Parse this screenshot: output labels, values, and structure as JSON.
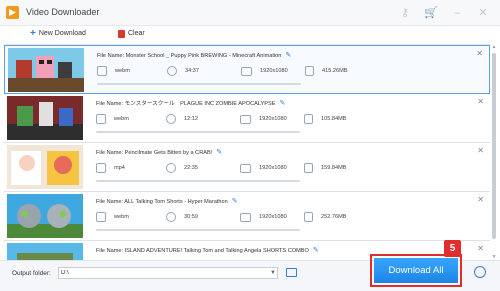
{
  "window": {
    "title": "Video Downloader"
  },
  "colors": {
    "accent": "#2e7fd8",
    "danger": "#e02d2d",
    "download_button": "#1d84e5"
  },
  "toolbar": {
    "new_download_label": "New Download",
    "clear_label": "Clear"
  },
  "list": {
    "filename_prefix": "File Name: ",
    "items": [
      {
        "filename": "Monster School _ Puppy Pink BREWING - Minecraft Animation",
        "format": "webm",
        "duration": "34:37",
        "resolution": "1920x1080",
        "size": "415.26MB",
        "progress": 0,
        "selected": true
      },
      {
        "filename": "モンスタースクール　PLAGUE INC ZOMBIE APOCALYPSE",
        "format": "webm",
        "duration": "12:12",
        "resolution": "1920x1080",
        "size": "105.84MB",
        "progress": 0,
        "selected": false
      },
      {
        "filename": "Pencilmate Gets Bitten by a CRAB!",
        "format": "mp4",
        "duration": "22:35",
        "resolution": "1920x1080",
        "size": "159.84MB",
        "progress": 0,
        "selected": false
      },
      {
        "filename": "ALL Talking Tom Shorts - Hyper Marathon",
        "format": "webm",
        "duration": "30:59",
        "resolution": "1920x1080",
        "size": "252.76MB",
        "progress": 0,
        "selected": false
      },
      {
        "filename": "ISLAND ADVENTURE! Talking Tom and Talking Angela SHORTS COMBO",
        "format": "",
        "duration": "",
        "resolution": "",
        "size": "",
        "progress": 0,
        "selected": false
      }
    ]
  },
  "footer": {
    "output_label": "Output folder:",
    "output_path": "D:\\",
    "download_all_label": "Download All",
    "step_badge": "5"
  },
  "icons": {
    "titlebar": [
      "key-icon",
      "cart-icon",
      "minimize-icon",
      "close-icon"
    ],
    "row": [
      "format-icon",
      "clock-icon",
      "resolution-icon",
      "filesize-icon",
      "pencil-icon",
      "close-icon"
    ]
  }
}
